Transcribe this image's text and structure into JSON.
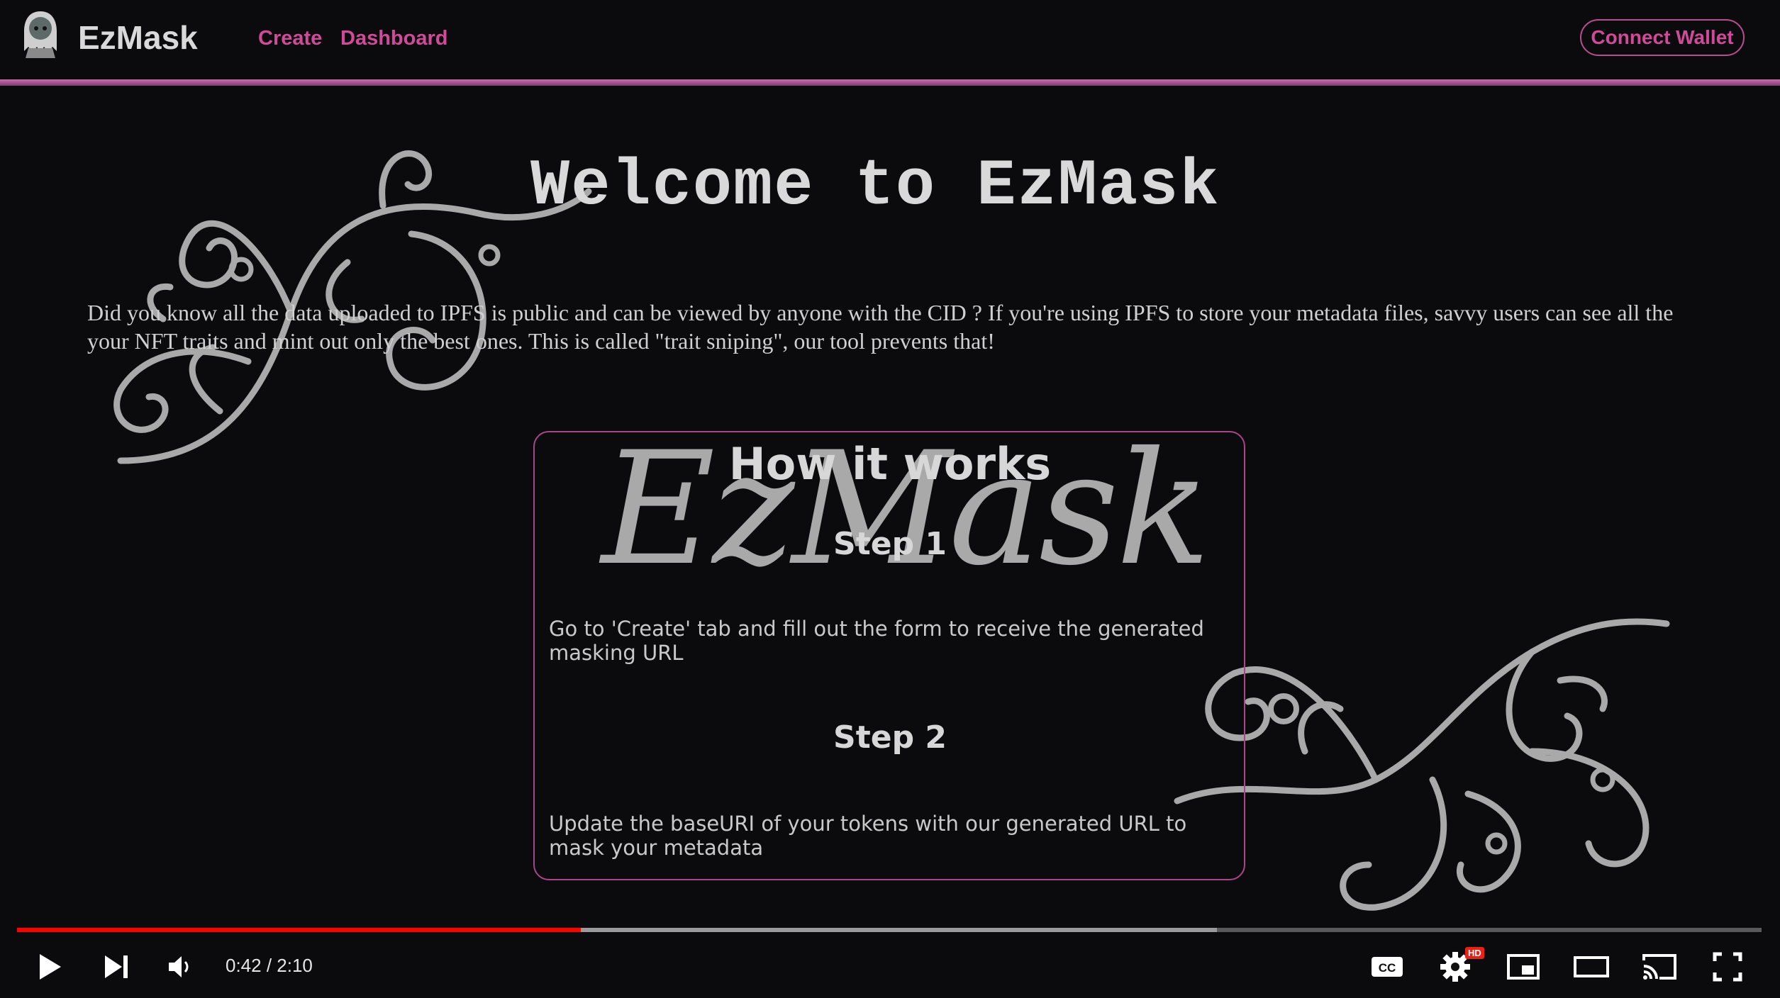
{
  "nav": {
    "brand": "EzMask",
    "links": [
      "Create",
      "Dashboard"
    ],
    "connect_label": "Connect Wallet"
  },
  "main": {
    "title": "Welcome to EzMask",
    "intro": "Did you know all the data uploaded to IPFS is public and can be viewed by anyone with the CID ? If you're using IPFS to store your metadata files, savvy users can see all the your NFT traits and mint out only the best ones. This is called \"trait sniping\", our tool prevents that!",
    "card": {
      "script_logo": "EzMask",
      "title": "How it works",
      "steps": [
        {
          "title": "Step 1",
          "text": "Go to 'Create' tab and fill out the form to receive the generated masking URL"
        },
        {
          "title": "Step 2",
          "text": "Update the baseURI of your tokens with our generated URL to mask your metadata"
        }
      ]
    }
  },
  "player": {
    "time": "0:42 / 2:10",
    "hd_badge": "HD",
    "progress_fraction": 0.323,
    "buffered_fraction": 0.688
  },
  "colors": {
    "background": "#0b0b0d",
    "accent": "#d04a9a",
    "progress": "#ff0000"
  }
}
